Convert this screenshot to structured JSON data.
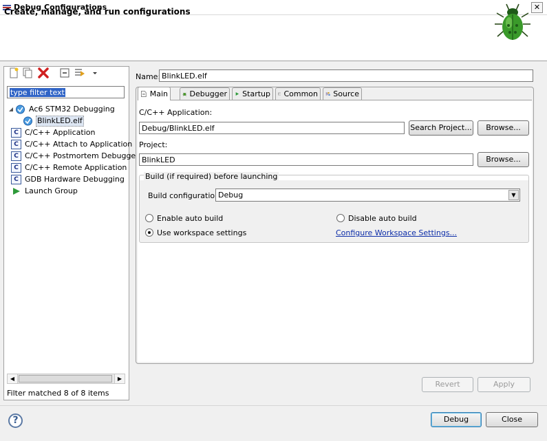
{
  "window": {
    "title": "Debug Configurations",
    "close_glyph": "✕"
  },
  "banner": {
    "title": "Create, manage, and run configurations"
  },
  "filter": {
    "value": "type filter text"
  },
  "tree": {
    "items": [
      {
        "label": "Ac6 STM32 Debugging",
        "icon": "ac6-debug-icon",
        "indent": 0,
        "expanded": true
      },
      {
        "label": "BlinkLED.elf",
        "icon": "ac6-debug-icon",
        "indent": 1,
        "selected": true
      },
      {
        "label": "C/C++ Application",
        "icon": "c-icon"
      },
      {
        "label": "C/C++ Attach to Application",
        "icon": "c-icon"
      },
      {
        "label": "C/C++ Postmortem Debugger",
        "icon": "c-icon"
      },
      {
        "label": "C/C++ Remote Application",
        "icon": "c-icon"
      },
      {
        "label": "GDB Hardware Debugging",
        "icon": "c-icon"
      },
      {
        "label": "Launch Group",
        "icon": "launch-group-icon"
      }
    ],
    "status": "Filter matched 8 of 8 items"
  },
  "config": {
    "name_label": "Name:",
    "name_value": "BlinkLED.elf",
    "tabs": [
      {
        "label": "Main",
        "icon": "main-tab-icon",
        "active": true
      },
      {
        "label": "Debugger",
        "icon": "debugger-tab-icon"
      },
      {
        "label": "Startup",
        "icon": "startup-tab-icon"
      },
      {
        "label": "Common",
        "icon": "common-tab-icon"
      },
      {
        "label": "Source",
        "icon": "source-tab-icon"
      }
    ],
    "main": {
      "app_label": "C/C++ Application:",
      "app_value": "Debug/BlinkLED.elf",
      "search_project": "Search Project...",
      "browse": "Browse...",
      "project_label": "Project:",
      "project_value": "BlinkLED",
      "build_group_label": "Build (if required) before launching",
      "build_config_label": "Build configuration:",
      "build_config_value": "Debug",
      "enable_auto_build": "Enable auto build",
      "disable_auto_build": "Disable auto build",
      "use_workspace": "Use workspace settings",
      "configure_link": "Configure Workspace Settings...",
      "selected_option": "use_workspace"
    },
    "revert": "Revert",
    "apply": "Apply"
  },
  "footer": {
    "help_glyph": "?",
    "debug": "Debug",
    "close": "Close"
  },
  "colors": {
    "selection": "#3064c6",
    "link": "#0b2ca8",
    "bug_green": "#3a9a2a"
  }
}
